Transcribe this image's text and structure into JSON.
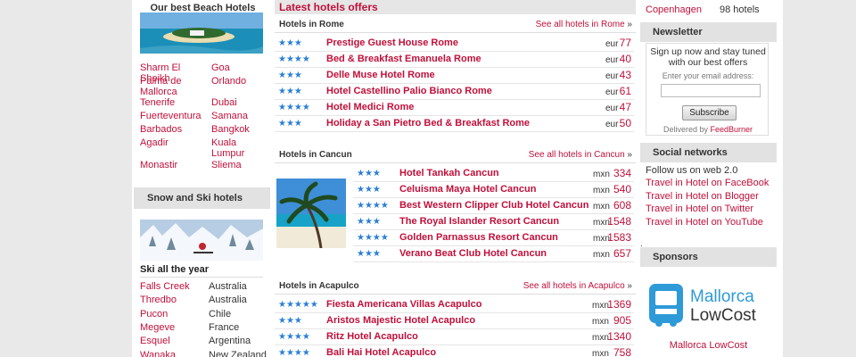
{
  "left": {
    "beach_title": "Our best Beach Hotels",
    "beach_destinations": [
      [
        "Sharm El Sheikh",
        "Goa"
      ],
      [
        "Palma de Mallorca",
        "Orlando"
      ],
      [
        "Tenerife",
        "Dubai"
      ],
      [
        "Fuerteventura",
        "Samana"
      ],
      [
        "Barbados",
        "Bangkok"
      ],
      [
        "Agadir",
        "Kuala Lumpur"
      ],
      [
        "Monastir",
        "Sliema"
      ]
    ],
    "snow_header": "Snow and Ski hotels",
    "ski_title": "Ski all the year",
    "ski_resorts": [
      {
        "resort": "Falls Creek",
        "country": "Australia"
      },
      {
        "resort": "Thredbo",
        "country": "Australia"
      },
      {
        "resort": "Pucon",
        "country": "Chile"
      },
      {
        "resort": "Megeve",
        "country": "France"
      },
      {
        "resort": "Esquel",
        "country": "Argentina"
      },
      {
        "resort": "Wanaka",
        "country": "New Zealand"
      }
    ]
  },
  "main": {
    "header": "Latest hotels offers",
    "sections": [
      {
        "title": "Hotels in Rome",
        "see_all": "See all hotels in Rome",
        "hotels": [
          {
            "stars": "★★★",
            "name": "Prestige Guest House Rome",
            "currency": "eur",
            "price": "77"
          },
          {
            "stars": "★★★★",
            "name": "Bed & Breakfast Emanuela Rome",
            "currency": "eur",
            "price": "40"
          },
          {
            "stars": "★★★",
            "name": "Delle Muse Hotel Rome",
            "currency": "eur",
            "price": "43"
          },
          {
            "stars": "★★★",
            "name": "Hotel Castellino Palio Bianco Rome",
            "currency": "eur",
            "price": "61"
          },
          {
            "stars": "★★★★",
            "name": "Hotel Medici Rome",
            "currency": "eur",
            "price": "47"
          },
          {
            "stars": "★★★",
            "name": "Holiday a San Pietro Bed & Breakfast Rome",
            "currency": "eur",
            "price": "50"
          }
        ]
      },
      {
        "title": "Hotels in Cancun",
        "see_all": "See all hotels in Cancun",
        "hotels": [
          {
            "stars": "★★★",
            "name": "Hotel Tankah Cancun",
            "currency": "mxn",
            "price": "334"
          },
          {
            "stars": "★★★",
            "name": "Celuisma Maya Hotel Cancun",
            "currency": "mxn",
            "price": "540"
          },
          {
            "stars": "★★★★",
            "name": "Best Western Clipper Club Hotel Cancun",
            "currency": "mxn",
            "price": "608"
          },
          {
            "stars": "★★★",
            "name": "The Royal Islander Resort Cancun",
            "currency": "mxn",
            "price": "1548"
          },
          {
            "stars": "★★★★",
            "name": "Golden Parnassus Resort Cancun",
            "currency": "mxn",
            "price": "1583"
          },
          {
            "stars": "★★★",
            "name": "Verano Beat Club Hotel Cancun",
            "currency": "mxn",
            "price": "657"
          }
        ]
      },
      {
        "title": "Hotels in Acapulco",
        "see_all": "See all hotels in Acapulco",
        "hotels": [
          {
            "stars": "★★★★★",
            "name": "Fiesta Americana Villas Acapulco",
            "currency": "mxn",
            "price": "1369"
          },
          {
            "stars": "★★★",
            "name": "Aristos Majestic Hotel Acapulco",
            "currency": "mxn",
            "price": "905"
          },
          {
            "stars": "★★★★",
            "name": "Ritz Hotel Acapulco",
            "currency": "mxn",
            "price": "1340"
          },
          {
            "stars": "★★★★",
            "name": "Bali Hai Hotel Acapulco",
            "currency": "mxn",
            "price": "758"
          }
        ]
      }
    ]
  },
  "right": {
    "city": "Copenhagen",
    "city_count": "98 hotels",
    "newsletter": {
      "header": "Newsletter",
      "text": "Sign up now and stay tuned with our best offers",
      "input_label": "Enter your email address:",
      "button": "Subscribe",
      "delivered_by": "Delivered by",
      "provider": "FeedBurner"
    },
    "social": {
      "header": "Social networks",
      "lead": "Follow us on web 2.0",
      "links": [
        "Travel in Hotel on FaceBook",
        "Travel in Hotel on Blogger",
        "Travel in Hotel on Twitter",
        "Travel in Hotel on YouTube"
      ]
    },
    "sponsors": {
      "header": "Sponsors",
      "logo_line1": "Mallorca",
      "logo_line2": "LowCost",
      "caption": "Mallorca LowCost"
    }
  }
}
